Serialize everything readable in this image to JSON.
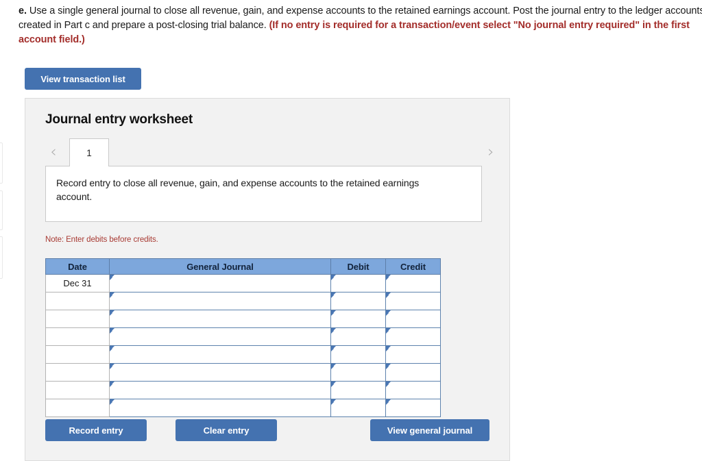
{
  "instructions": {
    "lead": "e.",
    "body": " Use a single general journal to close all revenue, gain, and expense accounts to the retained earnings account. Post the journal entry to the ledger accounts created in Part c and prepare a post-closing trial balance. ",
    "red_note": "(If no entry is required for a transaction/event select \"No journal entry required\" in the first account field.)"
  },
  "toolbar": {
    "view_transaction_list_label": "View transaction list"
  },
  "worksheet": {
    "title": "Journal entry worksheet",
    "prev_icon": "‹",
    "next_icon": "›",
    "tabs": [
      {
        "label": "1",
        "active": true
      }
    ],
    "description": "Record entry to close all revenue, gain, and expense accounts to the retained earnings account.",
    "note": "Note: Enter debits before credits.",
    "table": {
      "headers": [
        "Date",
        "General Journal",
        "Debit",
        "Credit"
      ],
      "rows": [
        {
          "date": "Dec 31",
          "general_journal": "",
          "debit": "",
          "credit": ""
        },
        {
          "date": "",
          "general_journal": "",
          "debit": "",
          "credit": ""
        },
        {
          "date": "",
          "general_journal": "",
          "debit": "",
          "credit": ""
        },
        {
          "date": "",
          "general_journal": "",
          "debit": "",
          "credit": ""
        },
        {
          "date": "",
          "general_journal": "",
          "debit": "",
          "credit": ""
        },
        {
          "date": "",
          "general_journal": "",
          "debit": "",
          "credit": ""
        },
        {
          "date": "",
          "general_journal": "",
          "debit": "",
          "credit": ""
        },
        {
          "date": "",
          "general_journal": "",
          "debit": "",
          "credit": ""
        }
      ]
    },
    "actions": {
      "record_entry_label": "Record entry",
      "clear_entry_label": "Clear entry",
      "view_general_journal_label": "View general journal"
    }
  },
  "colors": {
    "button_blue": "#4472b0",
    "table_header_blue": "#7da7dc",
    "note_red": "#a83a33",
    "instruction_red": "#a32d2a",
    "panel_gray": "#f2f2f2"
  }
}
